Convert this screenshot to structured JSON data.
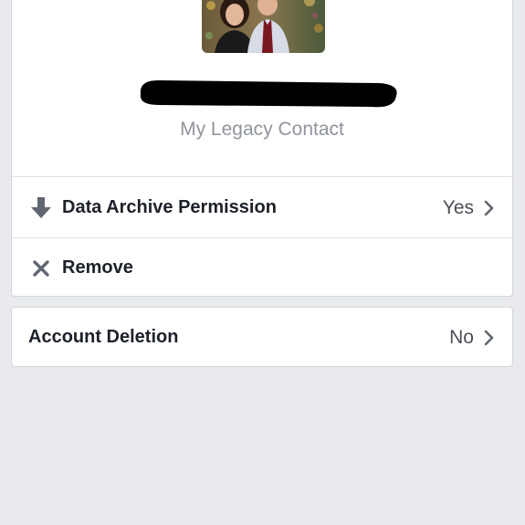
{
  "legacy_contact": {
    "subtitle": "My Legacy Contact"
  },
  "options": {
    "data_archive": {
      "label": "Data Archive Permission",
      "value": "Yes",
      "icon": "download-arrow-icon"
    },
    "remove": {
      "label": "Remove",
      "icon": "close-x-icon"
    }
  },
  "account_deletion": {
    "label": "Account Deletion",
    "value": "No"
  },
  "colors": {
    "background": "#e9eaed",
    "card": "#ffffff",
    "label": "#1d2129",
    "secondary": "#90949c",
    "icon": "#606770"
  }
}
